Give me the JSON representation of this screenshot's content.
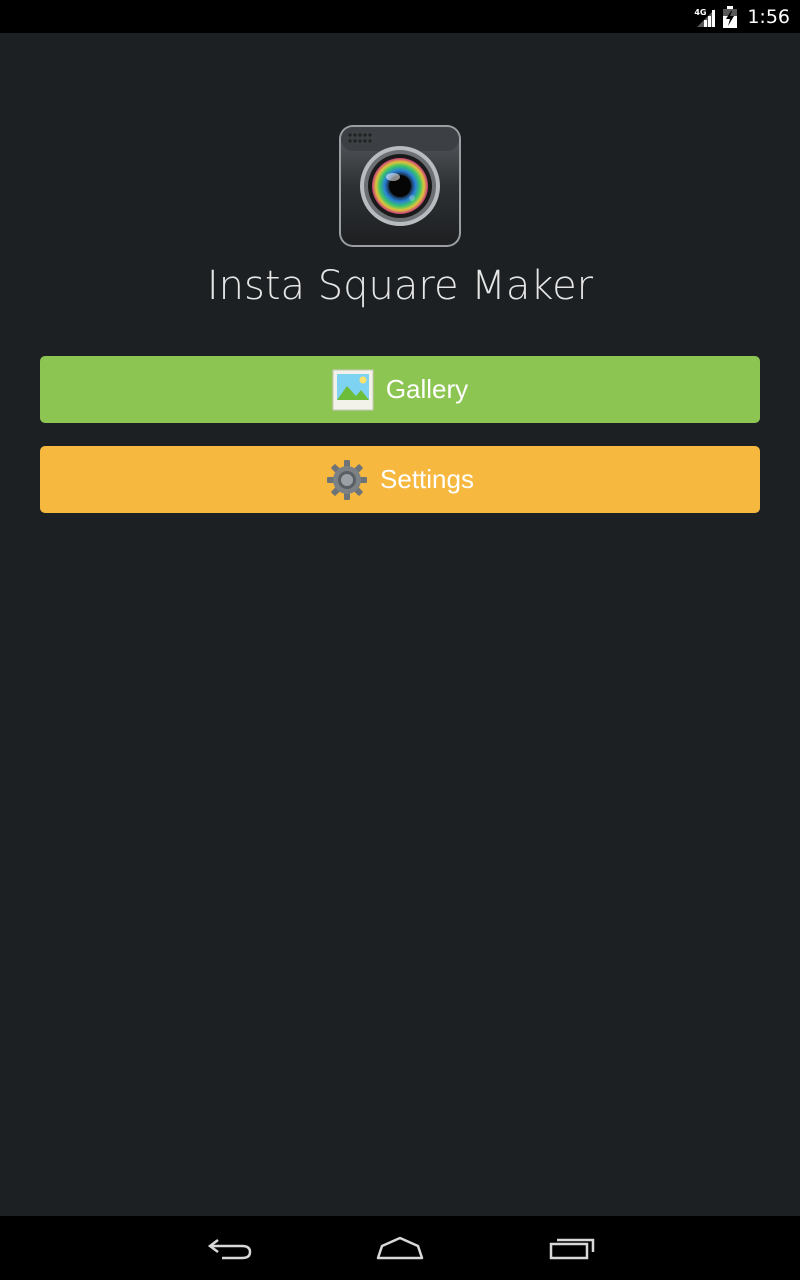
{
  "status_bar": {
    "network_type": "4G",
    "clock": "1:56",
    "icons": [
      "signal-icon",
      "battery-icon"
    ]
  },
  "app": {
    "title": "Insta Square Maker",
    "icon": "camera-icon"
  },
  "buttons": {
    "gallery": {
      "label": "Gallery",
      "icon": "gallery-icon",
      "color": "#8dc553"
    },
    "settings": {
      "label": "Settings",
      "icon": "gear-icon",
      "color": "#f7b840"
    }
  },
  "nav_bar": {
    "icons": [
      "back-icon",
      "home-icon",
      "recent-apps-icon"
    ]
  },
  "colors": {
    "background": "#1c2022",
    "system_bars": "#000000"
  }
}
